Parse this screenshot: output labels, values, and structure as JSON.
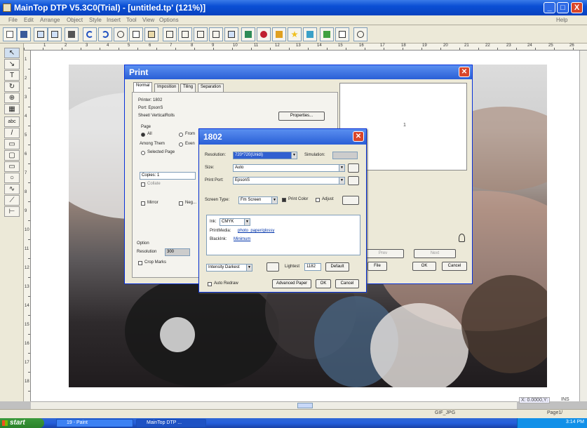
{
  "window": {
    "title": "MainTop DTP V5.3C0(Trial) - [untitled.tp' (121%)]",
    "min": "_",
    "max": "□",
    "close": "X"
  },
  "menu": [
    "File",
    "Edit",
    "Arrange",
    "Object",
    "Style",
    "Insert",
    "Tool",
    "View",
    "Options"
  ],
  "menu_help": "Help",
  "toolbar_icons": [
    "new-icon",
    "save-icon",
    "print-icon",
    "copy-page-icon",
    "open-icon",
    "undo-icon",
    "redo-icon",
    "cut-icon",
    "copy-icon",
    "paste-icon",
    "align-left-icon",
    "align-center-icon",
    "align-right-icon",
    "group-icon",
    "ungroup-icon",
    "color-icon",
    "shape-icon",
    "fill-icon",
    "star-icon",
    "image-icon",
    "chart-icon",
    "page-icon",
    "zoom-icon"
  ],
  "ruler_h": [
    "1",
    "2",
    "3",
    "4",
    "5",
    "6",
    "7",
    "8",
    "9",
    "10",
    "11",
    "12",
    "13",
    "14",
    "15",
    "16",
    "17",
    "18",
    "19",
    "20",
    "21",
    "22",
    "23",
    "24",
    "25",
    "26"
  ],
  "ruler_v": [
    "1",
    "2",
    "3",
    "4",
    "5",
    "6",
    "7",
    "8",
    "9",
    "10",
    "11",
    "12",
    "13",
    "14",
    "15",
    "16",
    "17",
    "18"
  ],
  "palette": [
    "↖",
    "↘",
    "T",
    "↻",
    "⊕",
    "▦",
    "abc",
    "/",
    "▭",
    "▢",
    "▭",
    "○",
    "∿",
    "⟋",
    "⊢"
  ],
  "print_dialog": {
    "title": "Print",
    "tabs": [
      "Normal",
      "Imposition",
      "Tiling",
      "Separation"
    ],
    "printer_label": "Printer: 1802",
    "port_label": "Port: EpsonS",
    "paper_label": "Sheet/ VerticalRolls",
    "properties": "Properties...",
    "page_label": "Page",
    "all": "All",
    "from": "From",
    "among_them": "Among Them",
    "even": "Even",
    "selected_page": "Selected Page",
    "copies_label": "Copies: 1",
    "collate": "Collate",
    "mirror": "Mirror",
    "negative": "Neg...",
    "option_label": "Option",
    "resolution_label": "Resolution",
    "resolution_value": "300",
    "crop_marks": "Crop Marks",
    "preview_page": "1",
    "ok": "OK",
    "cancel": "Cancel",
    "btn_prev": "Prev",
    "btn_next": "Next",
    "btn_file": "File"
  },
  "dlg_1802": {
    "title": "1802",
    "resolution_label": "Resolution:",
    "resolution_value": "720*720(Unidi)",
    "simulation_label": "Simulation:",
    "size_label": "Size:",
    "size_value": "Auto",
    "print_port_label": "Print Port:",
    "print_port_value": "EpsonS",
    "screen_type_label": "Screen Type:",
    "screen_type_value": "Fm Screen",
    "print_color": "Print Color",
    "adjust": "Adjust",
    "ink_label": "Ink:",
    "ink_value": "CMYK",
    "print_media_label": "PrintMedia:",
    "print_media_value": "photo_paper/glossy",
    "blackink_label": "BlackInk:",
    "blackink_value": "Minimum",
    "intensity_label": "Intensity Darkest",
    "lightest_label": "Lightest",
    "lightest_value": "1182",
    "default_btn": "Default",
    "auto_redraw": "Auto Redraw",
    "advanced_paper": "Advanced Paper",
    "ok": "OK",
    "cancel": "Cancel"
  },
  "statusbar": {
    "coords": "X: 0.0000,Y:",
    "mode": "INS",
    "file": "GIF_JPG",
    "page": "Page1/"
  },
  "taskbar": {
    "start": "start",
    "tasks": [
      "19 - Paint",
      "MainTop DTP ..."
    ],
    "clock": "3:14 PM"
  }
}
